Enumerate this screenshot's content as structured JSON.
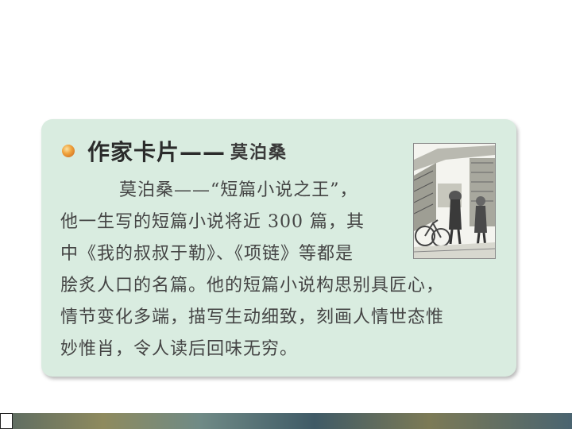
{
  "card": {
    "title": "作家卡片——",
    "author_name": "莫泊桑",
    "lines": [
      "莫泊桑——“短篇小说之王”，",
      "他一生写的短篇小说将近 300 篇，其",
      "中《我的叔叔于勒》、《项链》等都是",
      "脍炙人口的名篇。他的短篇小说构思别具匠心，",
      "情节变化多端，描写生动细致，刻画人情世态惟",
      "妙惟肖，令人读后回味无穷。"
    ],
    "bullet_color": "#f0a43e",
    "background_color": "#d9ece0",
    "portrait_icon": "street-scene-illustration"
  }
}
